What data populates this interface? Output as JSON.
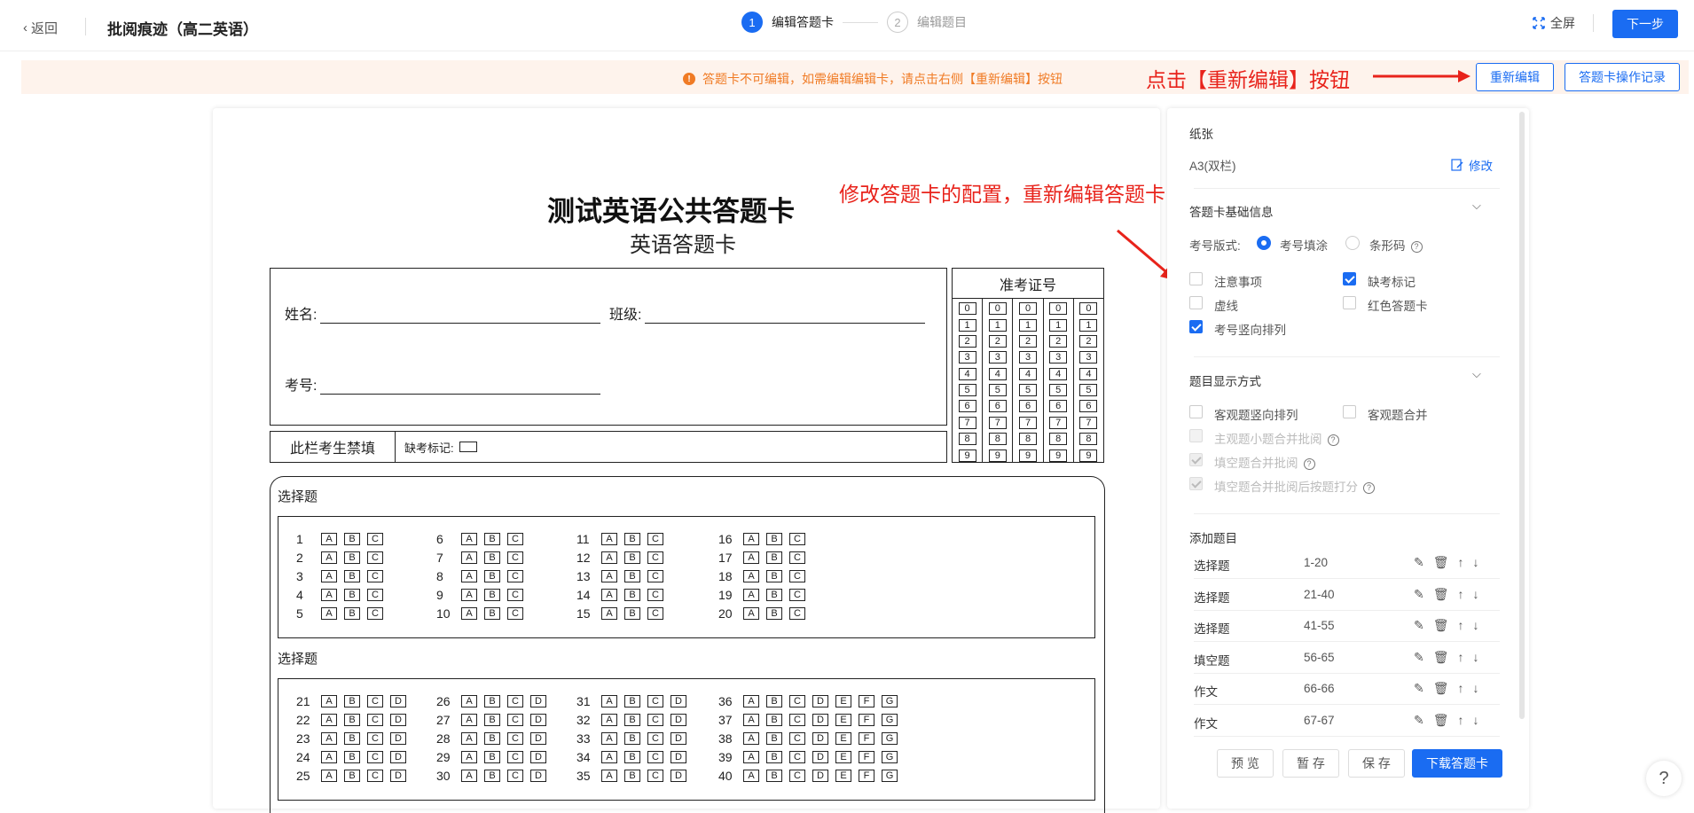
{
  "header": {
    "back_label": "返回",
    "title": "批阅痕迹（高二英语）",
    "steps": [
      {
        "num": "1",
        "label": "编辑答题卡"
      },
      {
        "num": "2",
        "label": "编辑题目"
      }
    ],
    "fullscreen_label": "全屏",
    "next_label": "下一步"
  },
  "notice": {
    "text": "答题卡不可编辑，如需编辑编辑卡，请点击右侧【重新编辑】按钮",
    "annotation": "点击【重新编辑】按钮",
    "reedit_label": "重新编辑",
    "log_label": "答题卡操作记录"
  },
  "sheet": {
    "title": "测试英语公共答题卡",
    "subtitle": "英语答题卡",
    "name_label": "姓名:",
    "class_label": "班级:",
    "examno_label": "考号:",
    "forbid_label": "此栏考生禁填",
    "absent_label": "缺考标记:",
    "zkz_title": "准考证号",
    "digits": [
      "0",
      "1",
      "2",
      "3",
      "4",
      "5",
      "6",
      "7",
      "8",
      "9"
    ],
    "section1_label": "选择题",
    "section2_label": "选择题",
    "section1_columns": [
      [
        "1",
        "2",
        "3",
        "4",
        "5"
      ],
      [
        "6",
        "7",
        "8",
        "9",
        "10"
      ],
      [
        "11",
        "12",
        "13",
        "14",
        "15"
      ],
      [
        "16",
        "17",
        "18",
        "19",
        "20"
      ]
    ],
    "section1_options": [
      "A",
      "B",
      "C"
    ],
    "section2_columns": [
      [
        "21",
        "22",
        "23",
        "24",
        "25"
      ],
      [
        "26",
        "27",
        "28",
        "29",
        "30"
      ],
      [
        "31",
        "32",
        "33",
        "34",
        "35"
      ],
      [
        "36",
        "37",
        "38",
        "39",
        "40"
      ]
    ],
    "section2_options_short": [
      "A",
      "B",
      "C",
      "D"
    ],
    "section2_options_long": [
      "A",
      "B",
      "C",
      "D",
      "E",
      "F",
      "G"
    ]
  },
  "annotation_mid": "修改答题卡的配置，重新编辑答题卡的题目区域",
  "panel": {
    "paper_label": "纸张",
    "paper_value": "A3(双栏)",
    "modify_label": "修改",
    "basic_title": "答题卡基础信息",
    "exam_format_label": "考号版式:",
    "radio_fill": "考号填涂",
    "radio_barcode": "条形码",
    "opt_notice": "注意事项",
    "opt_absent": "缺考标记",
    "opt_dashed": "虚线",
    "opt_red": "红色答题卡",
    "opt_vertical_examno": "考号竖向排列",
    "display_title": "题目显示方式",
    "opt_obj_vertical": "客观题竖向排列",
    "opt_obj_merge": "客观题合并",
    "opt_subj_merge": "主观题小题合并批阅",
    "opt_fill_merge": "填空题合并批阅",
    "opt_fill_merge_score": "填空题合并批阅后按题打分",
    "add_title": "添加题目",
    "questions": [
      {
        "type": "选择题",
        "range": "1-20"
      },
      {
        "type": "选择题",
        "range": "21-40"
      },
      {
        "type": "选择题",
        "range": "41-55"
      },
      {
        "type": "填空题",
        "range": "56-65"
      },
      {
        "type": "作文",
        "range": "66-66"
      },
      {
        "type": "作文",
        "range": "67-67"
      }
    ],
    "btn_preview": "预 览",
    "btn_temp": "暂 存",
    "btn_save": "保 存",
    "btn_download": "下载答题卡"
  },
  "help_label": "?"
}
